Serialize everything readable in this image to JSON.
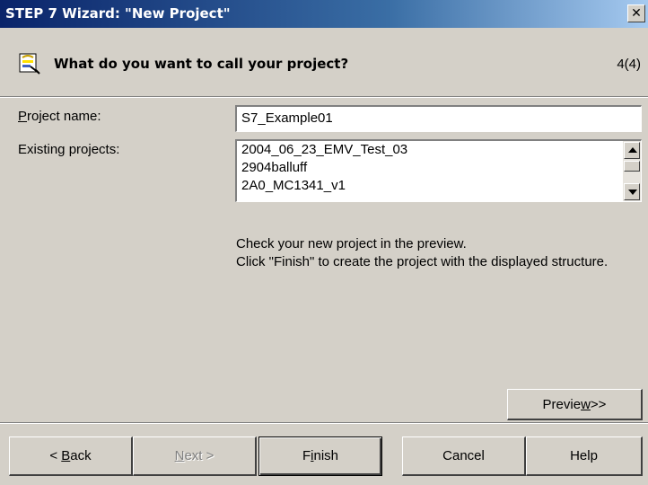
{
  "window": {
    "title": "STEP 7 Wizard: \"New Project\"",
    "close_glyph": "✕"
  },
  "header": {
    "icon": "wizard-icon",
    "question": "What do you want to call your project?",
    "step": "4(4)"
  },
  "form": {
    "project_name_label": "Project name:",
    "project_name_value": "S7_Example01",
    "existing_projects_label": "Existing projects:",
    "existing_projects": [
      "2004_06_23_EMV_Test_03",
      "2904balluff",
      "2A0_MC1341_v1"
    ]
  },
  "info": {
    "line1": "Check your new project in the preview.",
    "line2": "Click \"Finish\" to create the project with the displayed structure."
  },
  "buttons": {
    "preview": "Preview>>",
    "back": "< Back",
    "next": "Next >",
    "finish": "Finish",
    "cancel": "Cancel",
    "help": "Help"
  }
}
